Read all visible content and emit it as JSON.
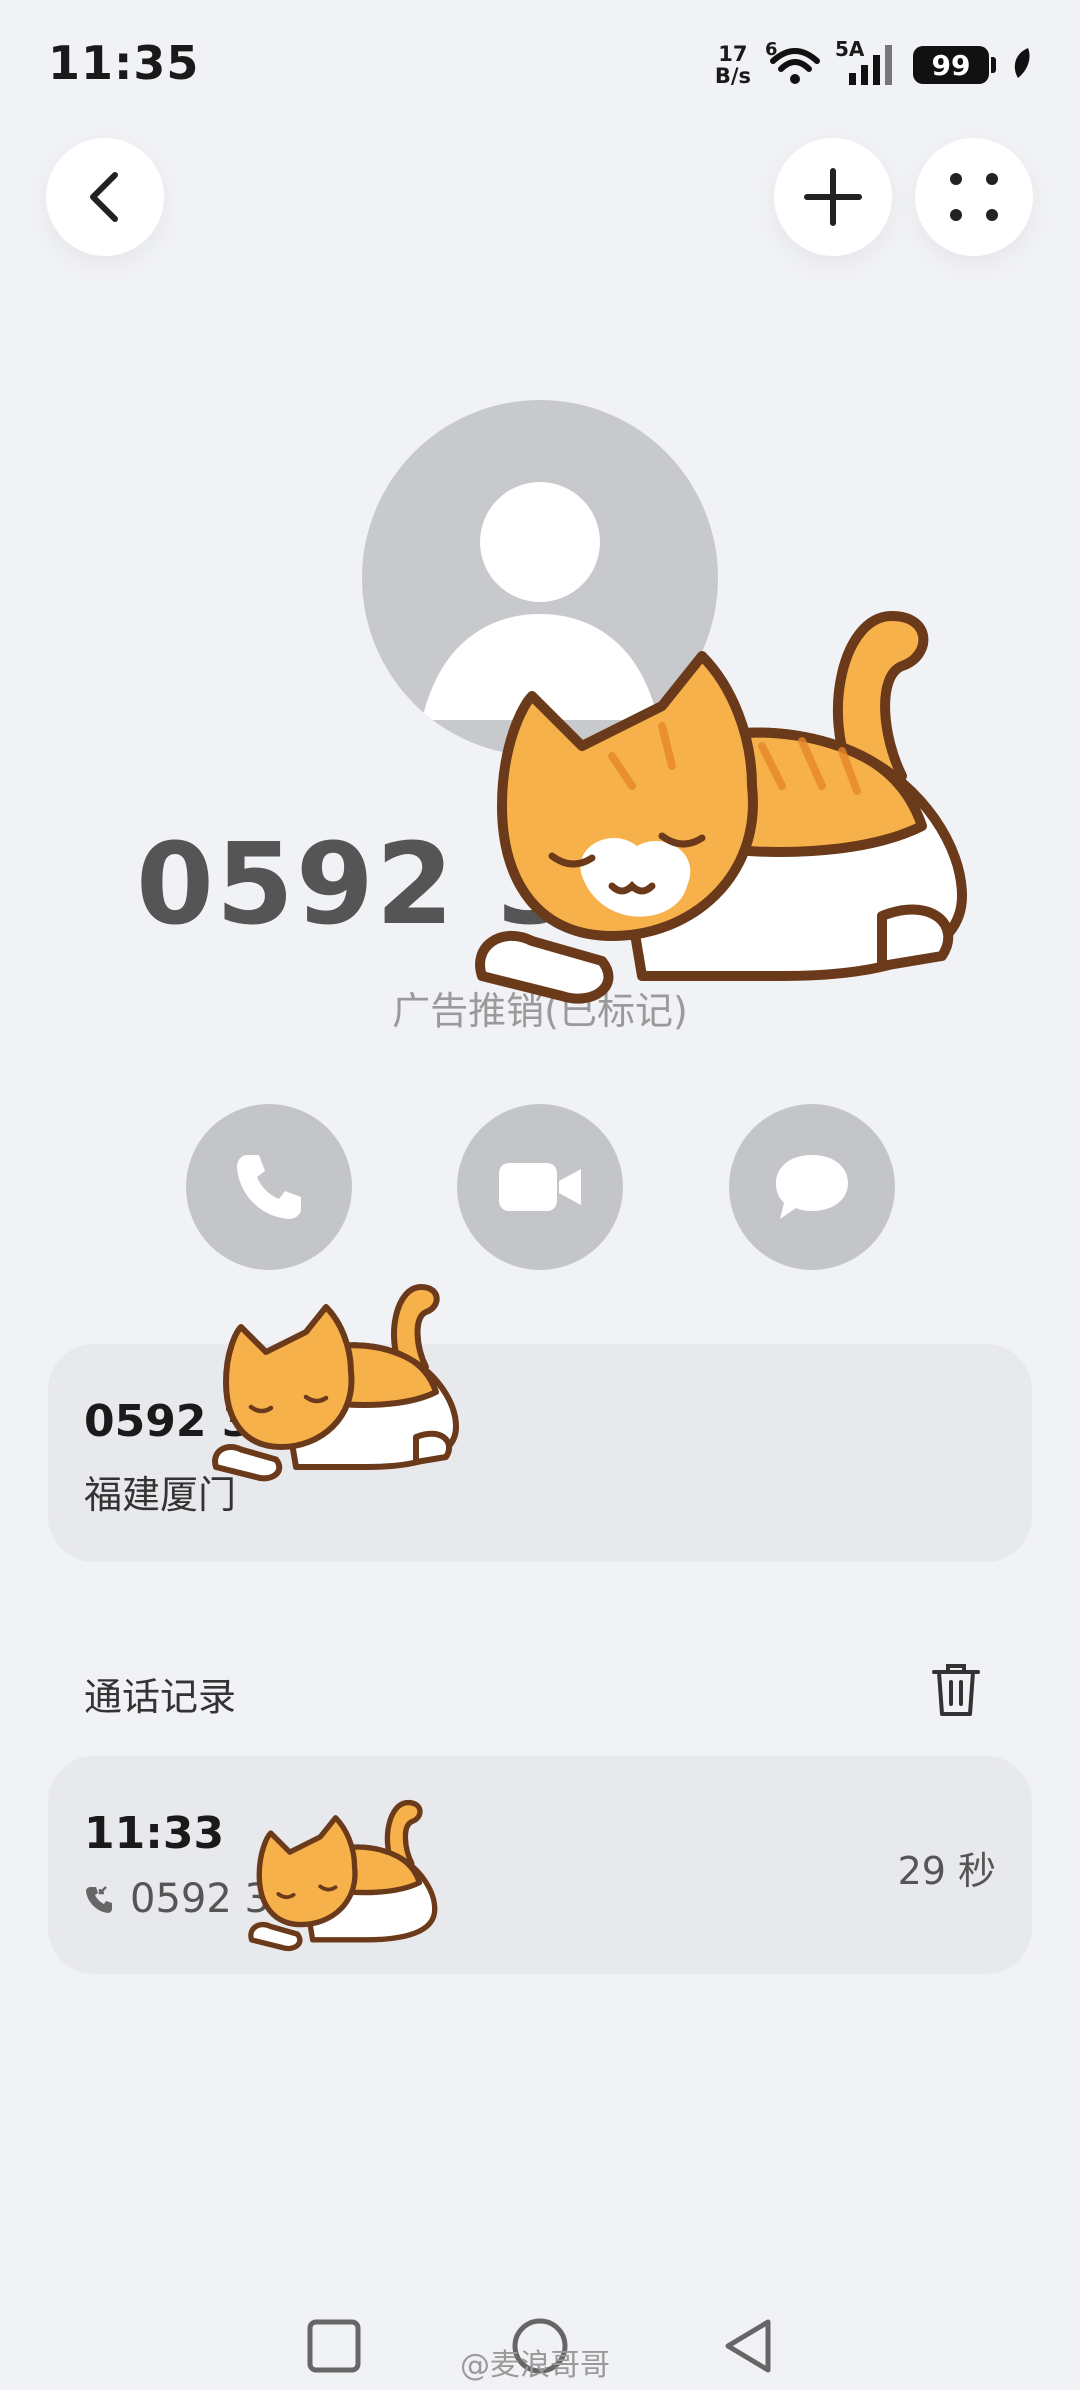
{
  "status_bar": {
    "time": "11:35",
    "net_speed_value": "17",
    "net_speed_unit": "B/s",
    "wifi_label": "6",
    "signal_label": "5A",
    "battery": "99"
  },
  "contact": {
    "number": "0592 3",
    "tag": "广告推销(已标记)",
    "card_number": "0592 3",
    "location": "福建厦门"
  },
  "call_log": {
    "section_title": "通话记录",
    "entries": [
      {
        "time": "11:33",
        "number": "0592 3",
        "duration": "29 秒"
      }
    ]
  },
  "watermark": "@麦浪哥哥",
  "colors": {
    "background": "#f1f2f5",
    "card": "#e8e9ec",
    "action_button": "#c4c5c9",
    "avatar": "#c8c9cc",
    "cat_orange": "#f7b14a",
    "cat_outline": "#6b3a1a"
  }
}
